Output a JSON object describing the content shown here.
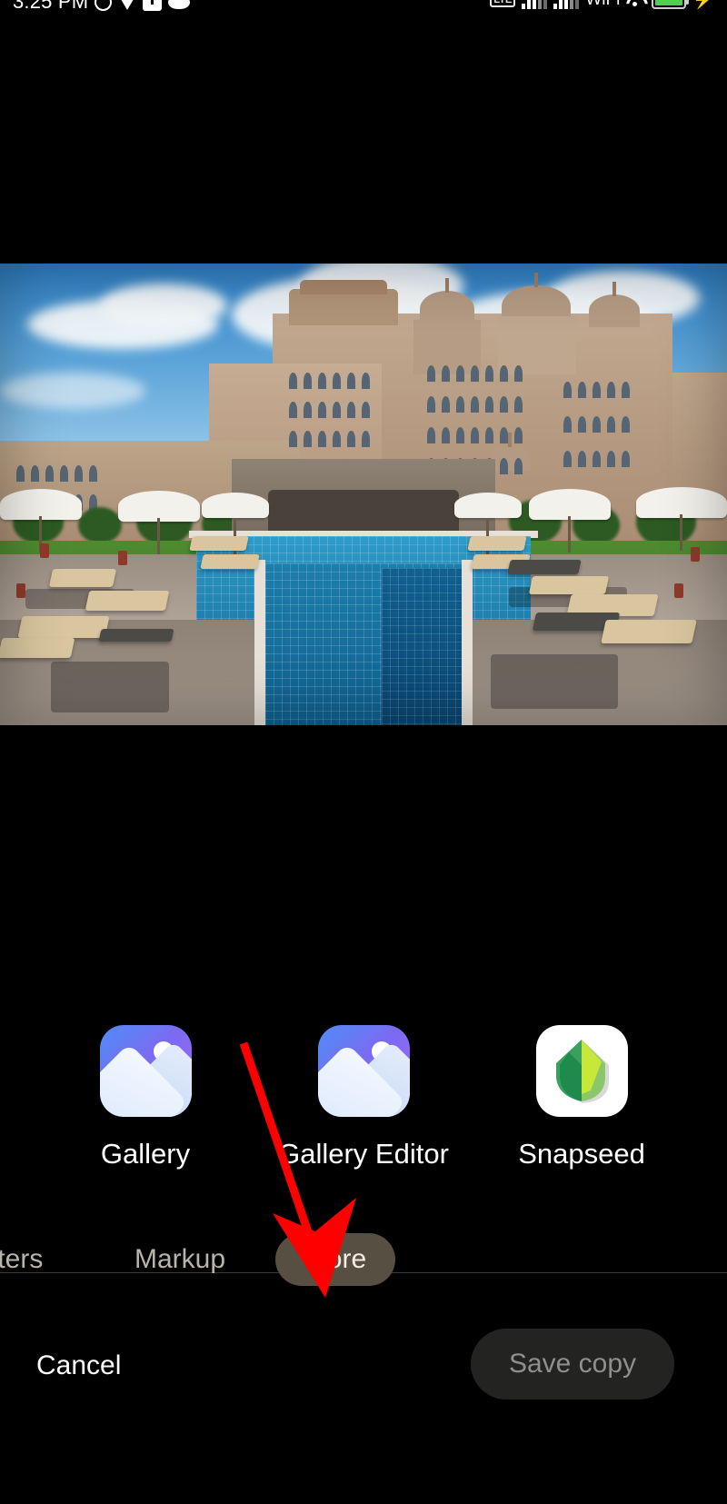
{
  "status_bar": {
    "time": "3:25 PM",
    "left_icons": [
      "clock-icon",
      "location-icon",
      "alert-icon",
      "cloud-icon"
    ],
    "network_label": "LTE",
    "wifi_label": "WiFi",
    "right_icons": [
      "lte-badge",
      "signal-bars-icon",
      "signal-bars-icon",
      "wifi-icon",
      "battery-icon",
      "charging-bolt-icon"
    ],
    "battery_color": "#4ad24a"
  },
  "photo": {
    "alt": "Luxury palace hotel resort with long blue tiled swimming pool, sun loungers and white umbrellas"
  },
  "share_sheet": {
    "apps": [
      {
        "label": "Gallery",
        "icon": "gallery-app-icon"
      },
      {
        "label": "Gallery Editor",
        "icon": "gallery-editor-app-icon"
      },
      {
        "label": "Snapseed",
        "icon": "snapseed-app-icon"
      }
    ]
  },
  "tool_tabs": {
    "items": [
      {
        "label": "ilters",
        "selected": false
      },
      {
        "label": "Markup",
        "selected": false
      },
      {
        "label": "More",
        "selected": true
      }
    ],
    "selected_pill_color": "#574f41"
  },
  "actions": {
    "cancel_label": "Cancel",
    "save_label": "Save copy",
    "save_button_color": "#232322"
  },
  "annotation": {
    "arrow_color": "#ff0000",
    "points_to": "More"
  }
}
